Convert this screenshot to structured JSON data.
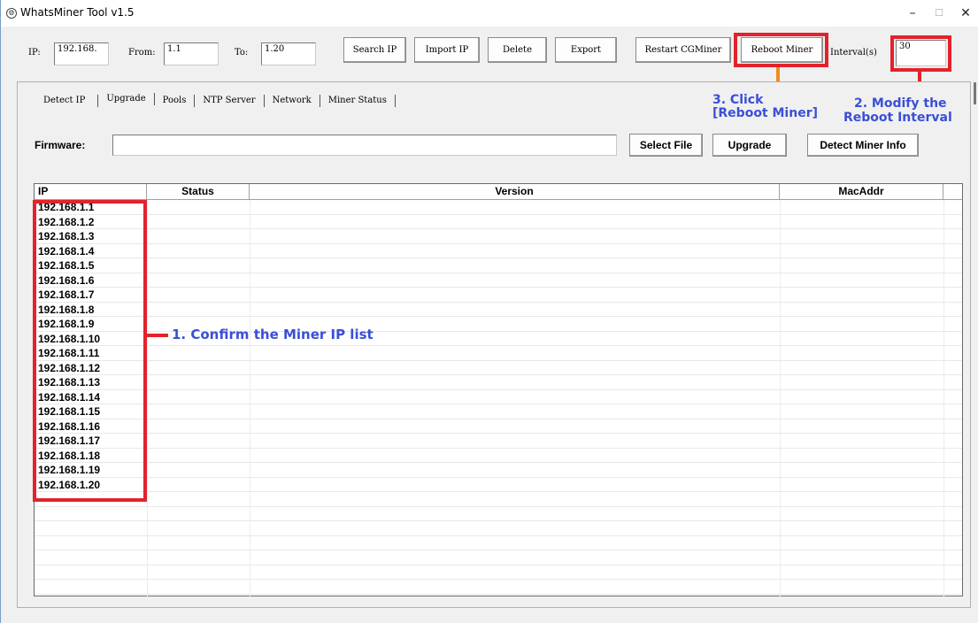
{
  "window": {
    "title": "WhatsMiner Tool v1.5",
    "icon": "app-logo-icon",
    "minimize": "–",
    "maximize": "☐",
    "close": "✕"
  },
  "toolbar": {
    "ip_label": "IP:",
    "ip_value": "192.168.",
    "from_label": "From:",
    "from_value": "1.1",
    "to_label": "To:",
    "to_value": "1.20",
    "search_ip": "Search IP",
    "import_ip": "Import IP",
    "delete": "Delete",
    "export": "Export",
    "restart_cgminer": "Restart CGMiner",
    "reboot_miner": "Reboot Miner",
    "interval_label": "Interval(s)",
    "interval_value": "30"
  },
  "tabs": [
    "Detect IP",
    "Upgrade",
    "Pools",
    "NTP Server",
    "Network",
    "Miner Status"
  ],
  "firmware": {
    "label": "Firmware:",
    "value": "",
    "select_file": "Select File",
    "upgrade": "Upgrade",
    "detect_info": "Detect Miner Info"
  },
  "table": {
    "columns": [
      "IP",
      "Status",
      "Version",
      "MacAddr"
    ],
    "rows": [
      "192.168.1.1",
      "192.168.1.2",
      "192.168.1.3",
      "192.168.1.4",
      "192.168.1.5",
      "192.168.1.6",
      "192.168.1.7",
      "192.168.1.8",
      "192.168.1.9",
      "192.168.1.10",
      "192.168.1.11",
      "192.168.1.12",
      "192.168.1.13",
      "192.168.1.14",
      "192.168.1.15",
      "192.168.1.16",
      "192.168.1.17",
      "192.168.1.18",
      "192.168.1.19",
      "192.168.1.20"
    ]
  },
  "annotations": {
    "step1": "1. Confirm the Miner IP list",
    "step2_line1": "2. Modify the",
    "step2_line2": "Reboot Interval",
    "step3_line1": "3. Click",
    "step3_line2": "[Reboot Miner]"
  },
  "colors": {
    "highlight_box": "#e3222b",
    "annotation_text": "#3a4fd6",
    "connector_orange": "#f08a24"
  }
}
